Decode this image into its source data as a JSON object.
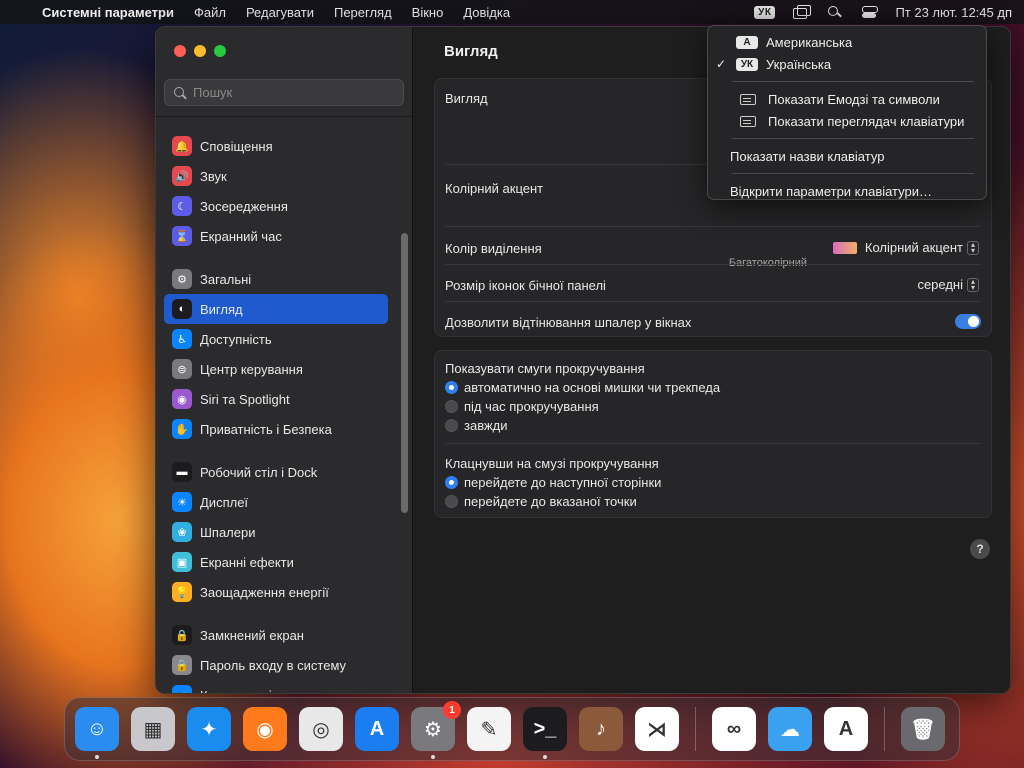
{
  "menubar": {
    "app_name": "Системні параметри",
    "items": [
      "Файл",
      "Редагувати",
      "Перегляд",
      "Вікно",
      "Довідка"
    ],
    "input_badge": "УК",
    "datetime": "Пт 23 лют.  12:45 дп"
  },
  "sidebar": {
    "search_placeholder": "Пошук",
    "groups": [
      [
        {
          "label": "Сповіщення",
          "icon": "bell-icon",
          "color": "#e5484d",
          "glyph": "🔔"
        },
        {
          "label": "Звук",
          "icon": "speaker-icon",
          "color": "#e5484d",
          "glyph": "🔊"
        },
        {
          "label": "Зосередження",
          "icon": "moon-icon",
          "color": "#5e5ce6",
          "glyph": "☾"
        },
        {
          "label": "Екранний час",
          "icon": "hourglass-icon",
          "color": "#5e5ce6",
          "glyph": "⌛"
        }
      ],
      [
        {
          "label": "Загальні",
          "icon": "gear-icon",
          "color": "#7a7a7e",
          "glyph": "⚙"
        },
        {
          "label": "Вигляд",
          "icon": "appearance-icon",
          "color": "#1c1c1e",
          "glyph": "◐",
          "active": true
        },
        {
          "label": "Доступність",
          "icon": "accessibility-icon",
          "color": "#0a84ff",
          "glyph": "♿"
        },
        {
          "label": "Центр керування",
          "icon": "control-center-icon",
          "color": "#7a7a7e",
          "glyph": "⊜"
        },
        {
          "label": "Siri та Spotlight",
          "icon": "siri-icon",
          "color": "#9b59d0",
          "glyph": "◉"
        },
        {
          "label": "Приватність і Безпека",
          "icon": "hand-icon",
          "color": "#0a84ff",
          "glyph": "✋"
        }
      ],
      [
        {
          "label": "Робочий стіл і Dock",
          "icon": "dock-icon",
          "color": "#1c1c1e",
          "glyph": "▬"
        },
        {
          "label": "Дисплеї",
          "icon": "sun-icon",
          "color": "#0a84ff",
          "glyph": "☀"
        },
        {
          "label": "Шпалери",
          "icon": "flower-icon",
          "color": "#30b0e0",
          "glyph": "❀"
        },
        {
          "label": "Екранні ефекти",
          "icon": "screensaver-icon",
          "color": "#40c0d8",
          "glyph": "▣"
        },
        {
          "label": "Заощадження енергії",
          "icon": "bulb-icon",
          "color": "#ffb020",
          "glyph": "💡"
        }
      ],
      [
        {
          "label": "Замкнений екран",
          "icon": "lock-screen-icon",
          "color": "#1c1c1e",
          "glyph": "🔒"
        },
        {
          "label": "Пароль входу в систему",
          "icon": "lock-icon",
          "color": "#8a8a8e",
          "glyph": "🔒"
        },
        {
          "label": "Користувачі та групи",
          "icon": "users-icon",
          "color": "#0a84ff",
          "glyph": "👥"
        }
      ]
    ]
  },
  "content": {
    "title": "Вигляд",
    "panel1": {
      "appearance_label": "Вигляд",
      "accent_label": "Колірний акцент",
      "accent_caption": "Багатоколірний",
      "highlight_label": "Колір виділення",
      "highlight_value": "Колірний акцент",
      "icon_size_label": "Розмір іконок бічної панелі",
      "icon_size_value": "середні",
      "tinting_label": "Дозволити відтінювання шпалер у вікнах"
    },
    "panel2": {
      "scrollbars_heading": "Показувати смуги прокручування",
      "scrollbar_options": [
        {
          "label": "автоматично на основі мишки чи трекпеда",
          "selected": true
        },
        {
          "label": "під час прокручування",
          "selected": false
        },
        {
          "label": "завжди",
          "selected": false
        }
      ],
      "click_heading": "Клацнувши на смузі прокручування",
      "click_options": [
        {
          "label": "перейдете до наступної сторінки",
          "selected": true
        },
        {
          "label": "перейдете до вказаної точки",
          "selected": false
        }
      ]
    },
    "help": "?"
  },
  "dropdown": {
    "sources": [
      {
        "badge": "A",
        "label": "Американська",
        "checked": false
      },
      {
        "badge": "УК",
        "label": "Українська",
        "checked": true
      }
    ],
    "viewer_items": [
      "Показати Емодзі та символи",
      "Показати переглядач клавіатури"
    ],
    "show_names": "Показати назви клавіатур",
    "open_settings": "Відкрити параметри клавіатури…"
  },
  "dock": {
    "apps": [
      {
        "name": "finder",
        "color": "#2b8cf0",
        "glyph": "☺",
        "running": true
      },
      {
        "name": "launchpad",
        "color": "#c8c8cc",
        "glyph": "▦",
        "running": false
      },
      {
        "name": "safari",
        "color": "#1a8cf0",
        "glyph": "✦",
        "running": false
      },
      {
        "name": "firefox",
        "color": "#ff7a1a",
        "glyph": "◉",
        "running": false
      },
      {
        "name": "chrome",
        "color": "#e8e8e8",
        "glyph": "◎",
        "running": false
      },
      {
        "name": "app-store",
        "color": "#1a7ef0",
        "glyph": "A",
        "running": false
      },
      {
        "name": "system-settings",
        "color": "#7a7a7e",
        "glyph": "⚙",
        "running": true,
        "badge": "1"
      },
      {
        "name": "textedit",
        "color": "#f4f4f4",
        "glyph": "✎",
        "running": false
      },
      {
        "name": "terminal",
        "color": "#1c1c1e",
        "glyph": ">_",
        "running": true
      },
      {
        "name": "garageband",
        "color": "#8a5a3a",
        "glyph": "♪",
        "running": false
      },
      {
        "name": "vscode",
        "color": "#ffffff",
        "glyph": "⋊",
        "running": false
      },
      {
        "name": "visual-studio",
        "color": "#ffffff",
        "glyph": "∞",
        "running": false
      },
      {
        "name": "weather",
        "color": "#3aa0f0",
        "glyph": "☁",
        "running": false
      },
      {
        "name": "xcode-instruments",
        "color": "#ffffff",
        "glyph": "A",
        "running": false
      },
      {
        "name": "trash",
        "color": "#6a6a6e",
        "glyph": "🗑",
        "running": false
      }
    ]
  }
}
